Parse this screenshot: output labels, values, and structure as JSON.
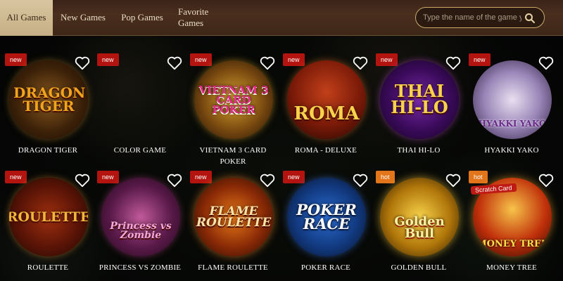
{
  "tabs": [
    {
      "label": "All Games",
      "active": true
    },
    {
      "label": "New Games"
    },
    {
      "label": "Pop Games"
    },
    {
      "label": "Favorite Games"
    }
  ],
  "search": {
    "placeholder": "Type the name of the game y"
  },
  "games": [
    {
      "name": "DRAGON TIGER",
      "badge": "new",
      "art": "DRAGON TIGER"
    },
    {
      "name": "COLOR GAME",
      "badge": "new",
      "art": ""
    },
    {
      "name": "VIETNAM 3 CARD POKER",
      "badge": "new",
      "art": "VIETNAM 3 CARD POKER"
    },
    {
      "name": "ROMA - DELUXE",
      "badge": "new",
      "art": "ROMA"
    },
    {
      "name": "THAI HI-LO",
      "badge": "new",
      "art": "THAI HI-LO"
    },
    {
      "name": "HYAKKI YAKO",
      "badge": "new",
      "art": "HYAKKI YAKO"
    },
    {
      "name": "ROULETTE",
      "badge": "new",
      "art": "ROULETTE"
    },
    {
      "name": "PRINCESS VS ZOMBIE",
      "badge": "new",
      "art": "Princess vs Zombie"
    },
    {
      "name": "FLAME ROULETTE",
      "badge": "new",
      "art": "FLAME ROULETTE"
    },
    {
      "name": "POKER RACE",
      "badge": "new",
      "art": "POKER RACE"
    },
    {
      "name": "GOLDEN BULL",
      "badge": "hot",
      "art": "Golden Bull"
    },
    {
      "name": "MONEY TREE",
      "badge": "hot",
      "art": "MONEY TREE",
      "tag": "Scratch Card"
    }
  ],
  "colors": {
    "new_badge": "#b3140f",
    "hot_badge": "#e2741a",
    "accent_gold": "#c9a96a"
  }
}
